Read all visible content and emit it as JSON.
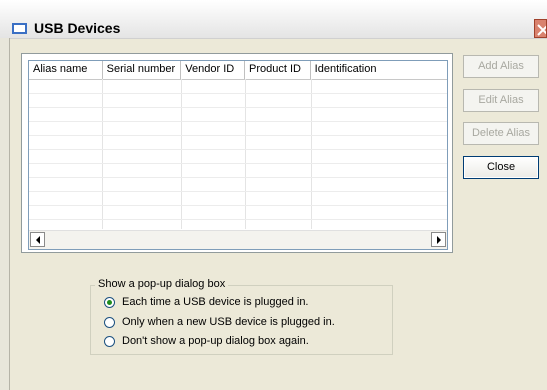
{
  "window": {
    "title": "USB Devices"
  },
  "table": {
    "columns": [
      "Alias name",
      "Serial number",
      "Vendor ID",
      "Product ID",
      "Identification"
    ],
    "rows": []
  },
  "buttons": {
    "add_alias": "Add Alias",
    "edit_alias": "Edit Alias",
    "delete_alias": "Delete Alias",
    "close": "Close"
  },
  "popup_group": {
    "legend": "Show a pop-up dialog box",
    "options": [
      "Each time a USB device is plugged in.",
      "Only when a new USB device is plugged in.",
      "Don't show a pop-up dialog box again."
    ],
    "selected_index": 0
  }
}
